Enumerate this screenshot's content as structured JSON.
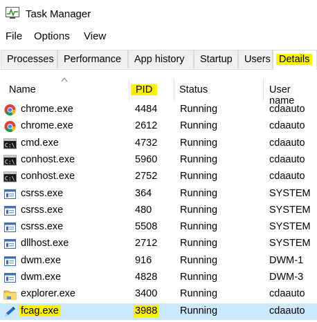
{
  "window": {
    "title": "Task Manager"
  },
  "menu": [
    "File",
    "Options",
    "View"
  ],
  "tabs": [
    "Processes",
    "Performance",
    "App history",
    "Startup",
    "Users",
    "Details"
  ],
  "active_tab": "Details",
  "columns": {
    "name": "Name",
    "pid": "PID",
    "status": "Status",
    "user": "User name"
  },
  "processes": [
    {
      "icon": "chrome-icon",
      "name": "chrome.exe",
      "pid": "4484",
      "status": "Running",
      "user": "cdaauto"
    },
    {
      "icon": "chrome-icon",
      "name": "chrome.exe",
      "pid": "2612",
      "status": "Running",
      "user": "cdaauto"
    },
    {
      "icon": "console-icon",
      "name": "cmd.exe",
      "pid": "4732",
      "status": "Running",
      "user": "cdaauto"
    },
    {
      "icon": "console-icon",
      "name": "conhost.exe",
      "pid": "5960",
      "status": "Running",
      "user": "cdaauto"
    },
    {
      "icon": "console-icon",
      "name": "conhost.exe",
      "pid": "2752",
      "status": "Running",
      "user": "cdaauto"
    },
    {
      "icon": "system-process-icon",
      "name": "csrss.exe",
      "pid": "364",
      "status": "Running",
      "user": "SYSTEM"
    },
    {
      "icon": "system-process-icon",
      "name": "csrss.exe",
      "pid": "480",
      "status": "Running",
      "user": "SYSTEM"
    },
    {
      "icon": "system-process-icon",
      "name": "csrss.exe",
      "pid": "5508",
      "status": "Running",
      "user": "SYSTEM"
    },
    {
      "icon": "system-process-icon",
      "name": "dllhost.exe",
      "pid": "2712",
      "status": "Running",
      "user": "SYSTEM"
    },
    {
      "icon": "system-process-icon",
      "name": "dwm.exe",
      "pid": "916",
      "status": "Running",
      "user": "DWM-1"
    },
    {
      "icon": "system-process-icon",
      "name": "dwm.exe",
      "pid": "4828",
      "status": "Running",
      "user": "DWM-3"
    },
    {
      "icon": "folder-icon",
      "name": "explorer.exe",
      "pid": "3400",
      "status": "Running",
      "user": "cdaauto"
    },
    {
      "icon": "pen-icon",
      "name": "fcag.exe",
      "pid": "3988",
      "status": "Running",
      "user": "cdaauto"
    }
  ],
  "colors": {
    "highlight": "#fff100",
    "selected_row": "#cce8ff"
  }
}
